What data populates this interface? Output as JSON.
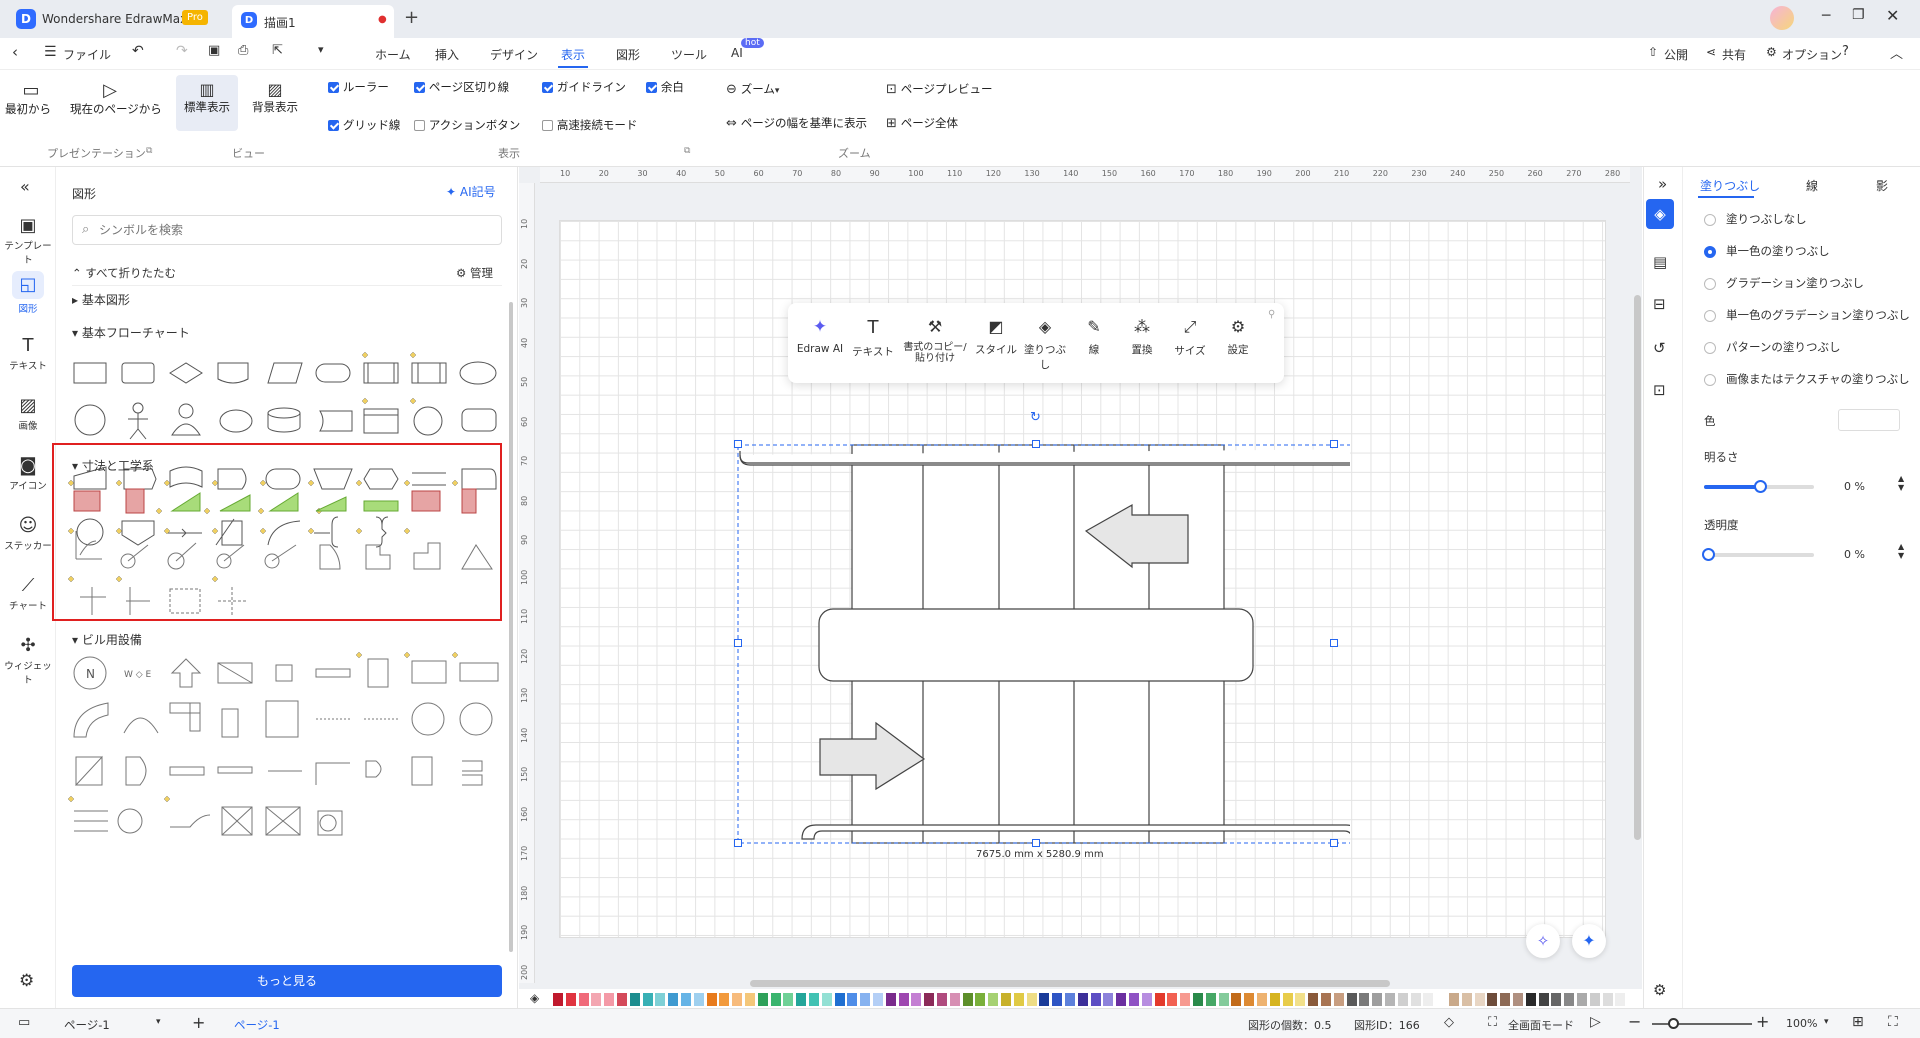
{
  "app": {
    "name": "Wondershare EdrawMax",
    "badge": "Pro",
    "doc_tab": "描画1"
  },
  "menu": {
    "file": "ファイル",
    "tabs": [
      "ホーム",
      "挿入",
      "デザイン",
      "表示",
      "図形",
      "ツール",
      "AI"
    ],
    "active_tab": "表示",
    "ai_badge": "hot",
    "right": [
      "公開",
      "共有",
      "オプション"
    ]
  },
  "ribbon": {
    "presentation": {
      "from_start": "最初から",
      "from_current": "現在のページから",
      "group": "プレゼンテーション"
    },
    "view": {
      "normal": "標準表示",
      "background": "背景表示",
      "group": "ビュー"
    },
    "display": {
      "ruler": "ルーラー",
      "page_break": "ページ区切り線",
      "guide": "ガイドライン",
      "margin": "余白",
      "grid": "グリッド線",
      "action_button": "アクションボタン",
      "fast_connect": "高速接続モード",
      "group": "表示"
    },
    "zoom": {
      "zoom": "ズーム",
      "fit_width": "ページの幅を基準に表示",
      "page_preview": "ページプレビュー",
      "whole_page": "ページ全体",
      "group": "ズーム"
    }
  },
  "rail": [
    {
      "label": "テンプレート"
    },
    {
      "label": "図形"
    },
    {
      "label": "テキスト"
    },
    {
      "label": "画像"
    },
    {
      "label": "アイコン"
    },
    {
      "label": "ステッカー"
    },
    {
      "label": "チャート"
    },
    {
      "label": "ウィジェット"
    }
  ],
  "panel": {
    "title": "図形",
    "ai_symbol": "AI記号",
    "search_placeholder": "シンボルを検索",
    "collapse_all": "すべて折りたたむ",
    "manage": "管理",
    "sections": [
      "基本図形",
      "基本フローチャート",
      "寸法と工学系",
      "ビル用設備"
    ],
    "more_button": "もっと見る"
  },
  "toolbar": {
    "items": [
      "Edraw AI",
      "テキスト",
      "書式のコピー/貼り付け",
      "スタイル",
      "塗りつぶし",
      "線",
      "置換",
      "サイズ",
      "設定"
    ]
  },
  "canvas": {
    "dimension_label": "7675.0 mm x 5280.9 mm",
    "ruler_h": [
      "10",
      "20",
      "30",
      "40",
      "50",
      "60",
      "70",
      "80",
      "90",
      "100",
      "110",
      "120",
      "130",
      "140",
      "150",
      "160",
      "170",
      "180",
      "190",
      "200",
      "210",
      "220",
      "230",
      "240",
      "250",
      "260",
      "270",
      "280"
    ],
    "ruler_v": [
      "10",
      "20",
      "30",
      "40",
      "50",
      "60",
      "70",
      "80",
      "90",
      "100",
      "110",
      "120",
      "130",
      "140",
      "150",
      "160",
      "170",
      "180",
      "190",
      "200"
    ]
  },
  "rpanel": {
    "tabs": [
      "塗りつぶし",
      "線",
      "影"
    ],
    "options": [
      "塗りつぶしなし",
      "単一色の塗りつぶし",
      "グラデーション塗りつぶし",
      "単一色のグラデーション塗りつぶし",
      "パターンの塗りつぶし",
      "画像またはテクスチャの塗りつぶし"
    ],
    "selected": 1,
    "color_label": "色",
    "brightness_label": "明るさ",
    "brightness_value": "0 %",
    "transparency_label": "透明度",
    "transparency_value": "0 %"
  },
  "status": {
    "page_tab": "ページ-1",
    "page_active": "ページ-1",
    "shape_count": "図形の個数：0.5",
    "shape_id": "図形ID：166",
    "fullscreen": "全画面モード",
    "zoom": "100%"
  },
  "colors": {
    "accent": "#2566f0",
    "highlight_red": "#e02020"
  }
}
